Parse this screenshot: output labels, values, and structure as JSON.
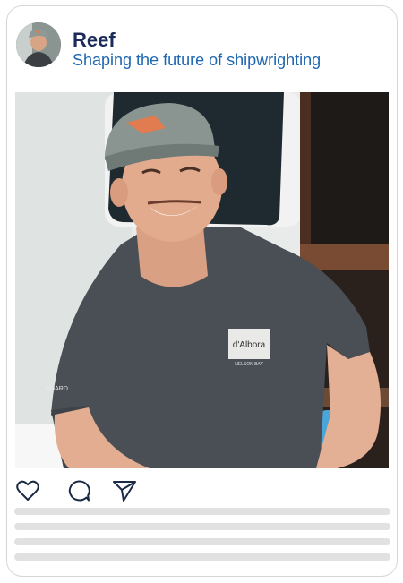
{
  "post": {
    "username": "Reef",
    "tagline": "Shaping the future of shipwrighting",
    "shirt_logo": "d'Albora",
    "shirt_logo_sub": "NELSON BAY",
    "sleeve_text": "BOARD"
  },
  "actions": [
    {
      "name": "like-button",
      "icon": "heart-icon"
    },
    {
      "name": "comment-button",
      "icon": "comment-icon"
    },
    {
      "name": "share-button",
      "icon": "send-icon"
    }
  ],
  "colors": {
    "username": "#1c2b5a",
    "tagline": "#1f67b0",
    "border": "#d6d6d6",
    "placeholder_line": "#e1e1e1"
  }
}
